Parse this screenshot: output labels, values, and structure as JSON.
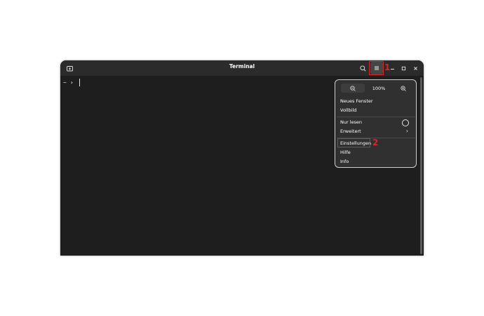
{
  "window": {
    "title": "Terminal"
  },
  "terminal": {
    "prompt_tilde": "~",
    "prompt_arrow": "›"
  },
  "menu": {
    "zoom_level": "100%",
    "items": [
      {
        "label": "Neues Fenster"
      },
      {
        "label": "Vollbild"
      },
      {
        "label": "Nur lesen"
      },
      {
        "label": "Erweitert"
      },
      {
        "label": "Einstellungen"
      },
      {
        "label": "Hilfe"
      },
      {
        "label": "Info"
      }
    ]
  },
  "annotations": {
    "step1": "1",
    "step2": "2"
  },
  "colors": {
    "annotation": "#d8252a",
    "terminal_bg": "#1e1e1e",
    "titlebar_bg": "#2b2b2b",
    "menu_bg": "#303030"
  }
}
